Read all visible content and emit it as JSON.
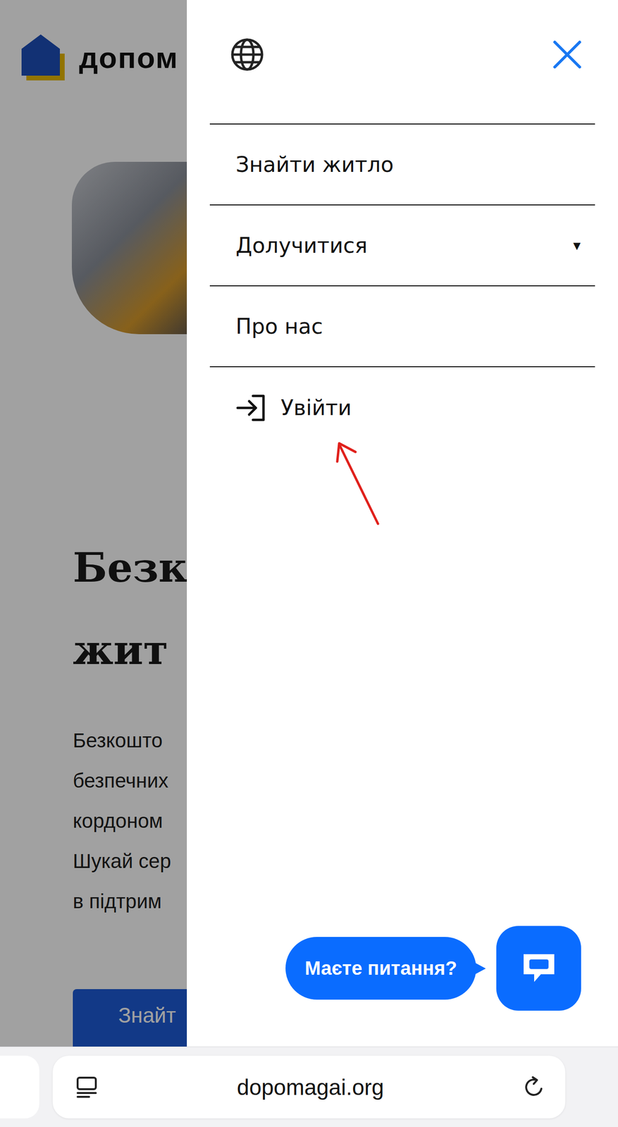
{
  "page": {
    "logo": "допом",
    "heading": [
      "Безк",
      "жит"
    ],
    "paragraph": [
      "Безкошто",
      "безпечних",
      "кордоном",
      "Шукай сер",
      "в підтрим"
    ],
    "button": "Знайт"
  },
  "menu": {
    "items": [
      {
        "label": "Знайти житло",
        "kind": "link"
      },
      {
        "label": "Долучитися",
        "kind": "dropdown",
        "expanded": false,
        "caret": "▼"
      },
      {
        "label": "Про нас",
        "kind": "link"
      },
      {
        "label": "Увійти",
        "kind": "login"
      }
    ]
  },
  "chat": {
    "prompt": "Маєте питання?"
  },
  "browser": {
    "url": "dopomagai.org"
  }
}
